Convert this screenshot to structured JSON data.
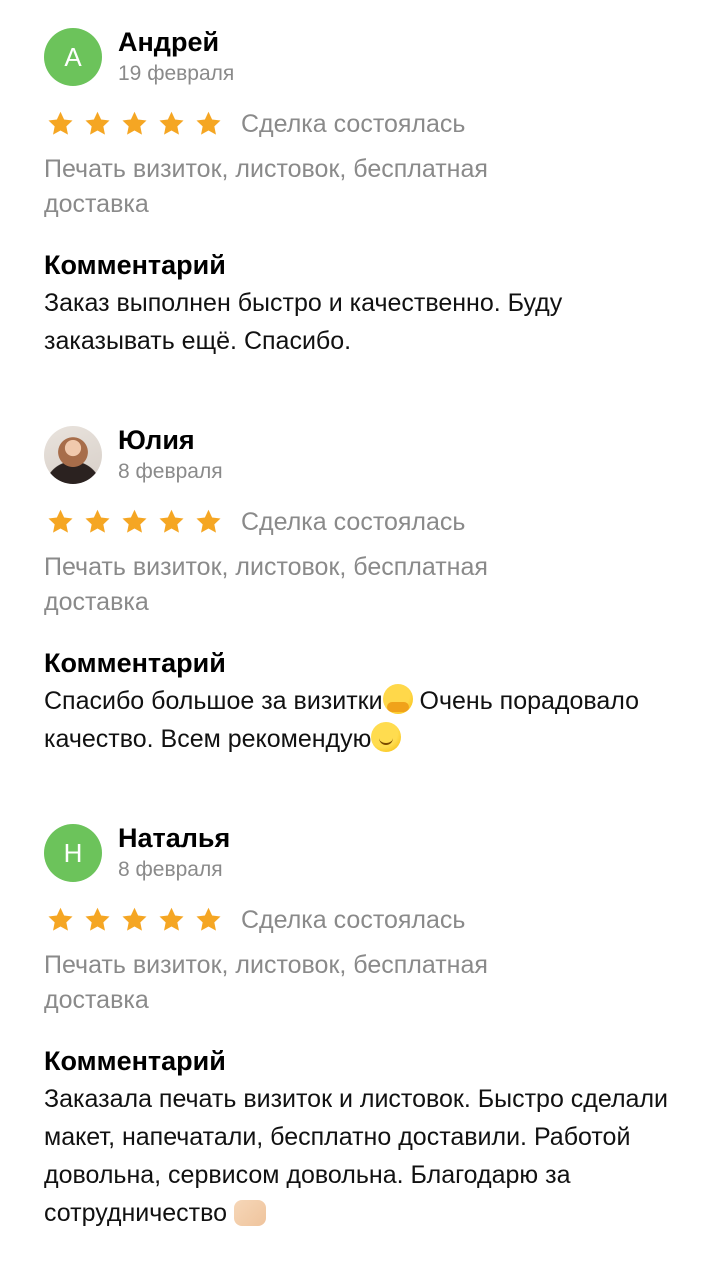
{
  "colors": {
    "star": "#f5a623",
    "avatar_green": "#6cc35b",
    "secondary_text": "#8a8a8a"
  },
  "reviews": [
    {
      "avatar_letter": "А",
      "name": "Андрей",
      "date": "19 февраля",
      "rating": 5,
      "deal_status": "Сделка состоялась",
      "service": "Печать визиток, листовок, бесплатная доставка",
      "comment_label": "Комментарий",
      "comment": "Заказ выполнен быстро и качественно. Буду заказывать ещё. Спасибо."
    },
    {
      "avatar_letter": "",
      "name": "Юлия",
      "date": "8 февраля",
      "rating": 5,
      "deal_status": "Сделка состоялась",
      "service": "Печать визиток, листовок, бесплатная доставка",
      "comment_label": "Комментарий",
      "comment_part1": "Спасибо большое за визитки",
      "comment_part2": " Очень порадовало качество. Всем рекомендую"
    },
    {
      "avatar_letter": "Н",
      "name": "Наталья",
      "date": "8 февраля",
      "rating": 5,
      "deal_status": "Сделка состоялась",
      "service": "Печать визиток, листовок, бесплатная доставка",
      "comment_label": "Комментарий",
      "comment": "Заказала печать визиток и листовок. Быстро сделали макет, напечатали, бесплатно доставили. Работой довольна, сервисом довольна. Благодарю за сотрудничество "
    }
  ]
}
